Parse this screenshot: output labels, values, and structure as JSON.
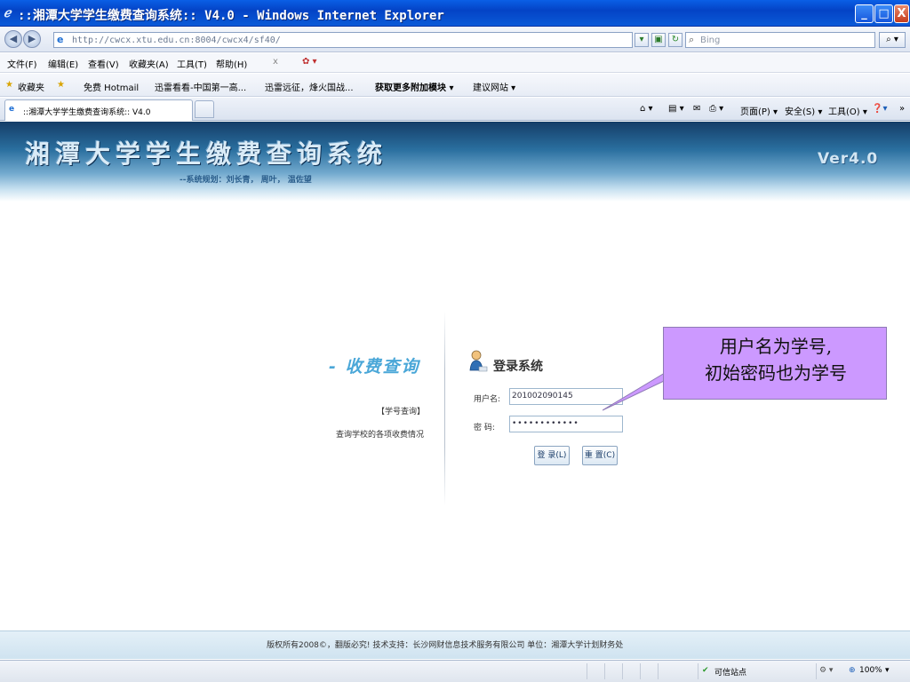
{
  "window": {
    "title": "::湘潭大学学生缴费查询系统:: V4.0 - Windows Internet Explorer",
    "minimize": "_",
    "maximize": "□",
    "close": "X"
  },
  "address": {
    "url": "http://cwcx.xtu.edu.cn:8004/cwcx4/sf40/",
    "search_placeholder": "Bing"
  },
  "menu": [
    "文件(F)",
    "编辑(E)",
    "查看(V)",
    "收藏夹(A)",
    "工具(T)",
    "帮助(H)",
    "x"
  ],
  "favorites": {
    "label": "收藏夹",
    "items": [
      "免费 Hotmail",
      "迅雷看看-中国第一高...",
      "迅雷远征，烽火国战...",
      "获取更多附加模块 ▾",
      "建议网站 ▾"
    ]
  },
  "tab": {
    "label": "::湘潭大学学生缴费查询系统:: V4.0"
  },
  "commands": [
    "页面(P) ▾",
    "安全(S) ▾",
    "工具(O) ▾"
  ],
  "banner": {
    "title": "湘潭大学学生缴费查询系统",
    "subtitle": "--系统规划：刘长青， 周叶， 温佐望",
    "version": "Ver4.0"
  },
  "left_panel": {
    "title": "- 收费查询",
    "link": "【学号查询】",
    "desc": "查询学校的各项收费情况"
  },
  "login": {
    "title": "登录系统",
    "username_label": "用户名:",
    "username_value": "201002090145",
    "password_label": "密  码:",
    "password_value": "••••••••••••",
    "login_button": "登 录(L)",
    "reset_button": "重 置(C)"
  },
  "callout": {
    "line1": "用户名为学号,",
    "line2": "初始密码也为学号",
    "color": "#cc99ff"
  },
  "footer": {
    "text": "版权所有2008©，翻版必究!  技术支持：长沙网财信息技术服务有限公司 单位：湘潭大学计划财务处"
  },
  "status": {
    "trusted": "可信站点",
    "zoom": "100%"
  }
}
